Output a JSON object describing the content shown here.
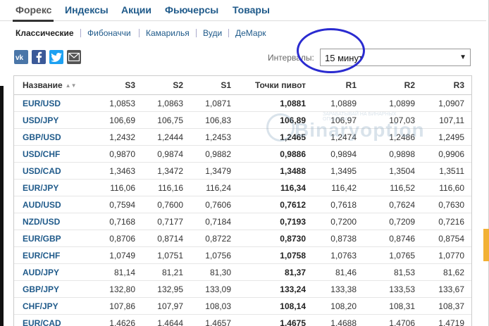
{
  "tabs": [
    {
      "label": "Форекс",
      "active": true
    },
    {
      "label": "Индексы",
      "active": false
    },
    {
      "label": "Акции",
      "active": false
    },
    {
      "label": "Фьючерсы",
      "active": false
    },
    {
      "label": "Товары",
      "active": false
    }
  ],
  "subnav": [
    {
      "label": "Классические",
      "active": true
    },
    {
      "label": "Фибоначчи",
      "active": false
    },
    {
      "label": "Камарилья",
      "active": false
    },
    {
      "label": "Вуди",
      "active": false
    },
    {
      "label": "ДеМарк",
      "active": false
    }
  ],
  "social": [
    {
      "icon": "vk-icon",
      "color": "#4a76a8"
    },
    {
      "icon": "facebook-icon",
      "color": "#3b5998"
    },
    {
      "icon": "twitter-icon",
      "color": "#1da1f2"
    },
    {
      "icon": "email-icon",
      "color": "#555555"
    }
  ],
  "interval": {
    "label": "Интервалы:",
    "value": "15 минут"
  },
  "watermark": {
    "text": "Binaryoption",
    "sub": "ЗАРАБАТЫВАЙ НА БИНАРНЫХ ОПЦИОНАХ"
  },
  "table": {
    "headers": [
      "Название",
      "S3",
      "S2",
      "S1",
      "Точки пивот",
      "R1",
      "R2",
      "R3"
    ],
    "rows": [
      [
        "EUR/USD",
        "1,0853",
        "1,0863",
        "1,0871",
        "1,0881",
        "1,0889",
        "1,0899",
        "1,0907"
      ],
      [
        "USD/JPY",
        "106,69",
        "106,75",
        "106,83",
        "106,89",
        "106,97",
        "107,03",
        "107,11"
      ],
      [
        "GBP/USD",
        "1,2432",
        "1,2444",
        "1,2453",
        "1,2465",
        "1,2474",
        "1,2486",
        "1,2495"
      ],
      [
        "USD/CHF",
        "0,9870",
        "0,9874",
        "0,9882",
        "0,9886",
        "0,9894",
        "0,9898",
        "0,9906"
      ],
      [
        "USD/CAD",
        "1,3463",
        "1,3472",
        "1,3479",
        "1,3488",
        "1,3495",
        "1,3504",
        "1,3511"
      ],
      [
        "EUR/JPY",
        "116,06",
        "116,16",
        "116,24",
        "116,34",
        "116,42",
        "116,52",
        "116,60"
      ],
      [
        "AUD/USD",
        "0,7594",
        "0,7600",
        "0,7606",
        "0,7612",
        "0,7618",
        "0,7624",
        "0,7630"
      ],
      [
        "NZD/USD",
        "0,7168",
        "0,7177",
        "0,7184",
        "0,7193",
        "0,7200",
        "0,7209",
        "0,7216"
      ],
      [
        "EUR/GBP",
        "0,8706",
        "0,8714",
        "0,8722",
        "0,8730",
        "0,8738",
        "0,8746",
        "0,8754"
      ],
      [
        "EUR/CHF",
        "1,0749",
        "1,0751",
        "1,0756",
        "1,0758",
        "1,0763",
        "1,0765",
        "1,0770"
      ],
      [
        "AUD/JPY",
        "81,14",
        "81,21",
        "81,30",
        "81,37",
        "81,46",
        "81,53",
        "81,62"
      ],
      [
        "GBP/JPY",
        "132,80",
        "132,95",
        "133,09",
        "133,24",
        "133,38",
        "133,53",
        "133,67"
      ],
      [
        "CHF/JPY",
        "107,86",
        "107,97",
        "108,03",
        "108,14",
        "108,20",
        "108,31",
        "108,37"
      ],
      [
        "EUR/CAD",
        "1,4626",
        "1,4644",
        "1,4657",
        "1,4675",
        "1,4688",
        "1,4706",
        "1,4719"
      ]
    ]
  }
}
